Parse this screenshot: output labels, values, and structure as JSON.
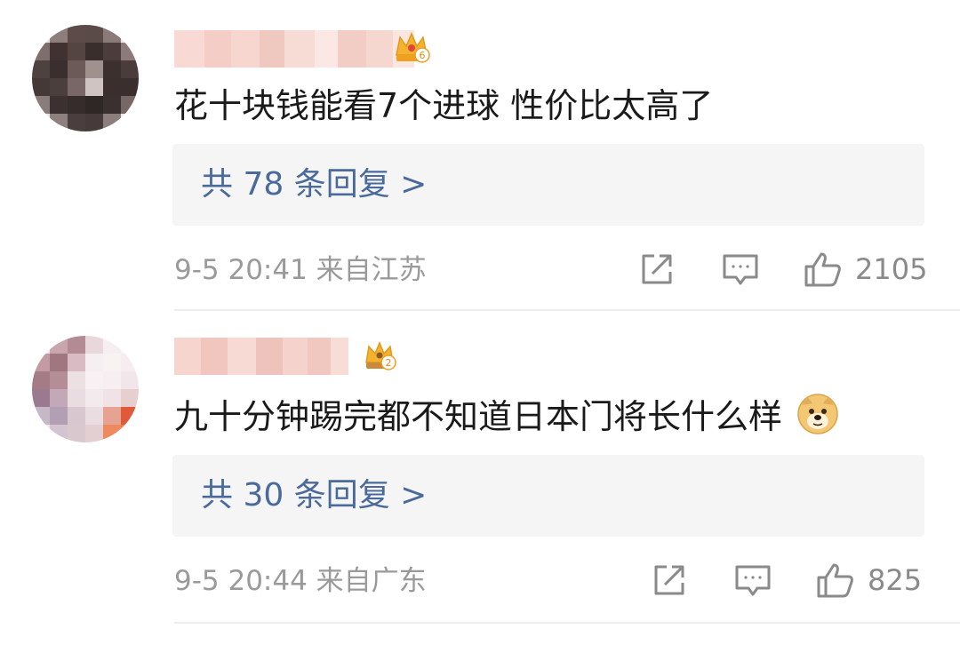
{
  "comments": [
    {
      "text": "花十块钱能看7个进球 性价比太高了",
      "badge_level": "6",
      "reply_summary": "共 78 条回复 >",
      "meta": "9-5 20:41 来自江苏",
      "likes": "2105",
      "icons": [
        "crown-badge-icon",
        "share-icon",
        "comment-icon",
        "thumbs-up-icon"
      ]
    },
    {
      "text": "九十分钟踢完都不知道日本门将长什么样",
      "emoji": "doge-emoji-icon",
      "badge_level": "2",
      "reply_summary": "共 30 条回复 >",
      "meta": "9-5 20:44 来自广东",
      "likes": "825",
      "icons": [
        "crown-badge-icon",
        "share-icon",
        "comment-icon",
        "thumbs-up-icon"
      ]
    }
  ],
  "colors": {
    "link": "#4a6a9c",
    "meta": "#9a9a9a",
    "reply_bg": "#f5f5f5",
    "badge": "#f5b22e"
  }
}
